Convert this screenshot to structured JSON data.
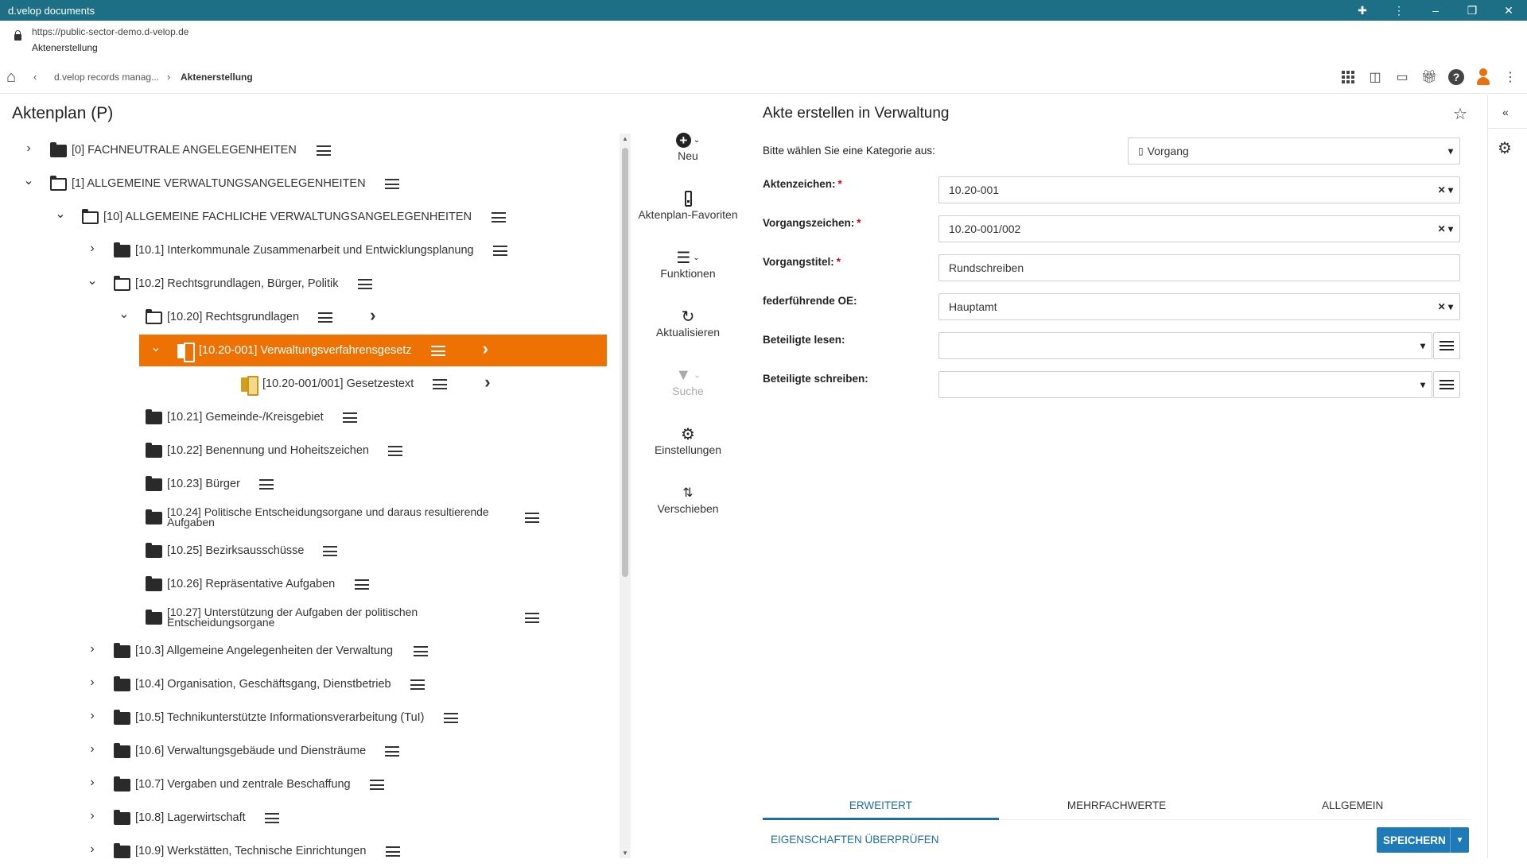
{
  "window": {
    "title": "d.velop documents"
  },
  "browser": {
    "url": "https://public-sector-demo.d-velop.de",
    "page_title": "Aktenerstellung"
  },
  "breadcrumb": {
    "parent": "d.velop records manag...",
    "current": "Aktenerstellung"
  },
  "tree": {
    "title": "Aktenplan (P)",
    "rows": [
      {
        "label": "[0] FACHNEUTRALE ANGELEGENHEITEN"
      },
      {
        "label": "[1] ALLGEMEINE VERWALTUNGSANGELEGENHEITEN"
      },
      {
        "label": "[10] ALLGEMEINE FACHLICHE VERWALTUNGSANGELEGENHEITEN"
      },
      {
        "label": "[10.1] Interkommunale Zusammenarbeit und Entwicklungsplanung"
      },
      {
        "label": "[10.2] Rechtsgrundlagen, Bürger, Politik"
      },
      {
        "label": "[10.20] Rechtsgrundlagen"
      },
      {
        "label": "[10.20-001] Verwaltungsverfahrensgesetz"
      },
      {
        "label": "[10.20-001/001] Gesetzestext"
      },
      {
        "label": "[10.21] Gemeinde-/Kreisgebiet"
      },
      {
        "label": "[10.22] Benennung und Hoheitszeichen"
      },
      {
        "label": "[10.23] Bürger"
      },
      {
        "label": "[10.24] Politische Entscheidungsorgane und daraus resultierende Aufgaben"
      },
      {
        "label": "[10.25] Bezirksausschüsse"
      },
      {
        "label": "[10.26] Repräsentative Aufgaben"
      },
      {
        "label": "[10.27] Unterstützung der Aufgaben der politischen Entscheidungsorgane"
      },
      {
        "label": "[10.3] Allgemeine Angelegenheiten der Verwaltung"
      },
      {
        "label": "[10.4] Organisation, Geschäftsgang, Dienstbetrieb"
      },
      {
        "label": "[10.5] Technikunterstützte Informationsverarbeitung (TuI)"
      },
      {
        "label": "[10.6] Verwaltungsgebäude und Diensträume"
      },
      {
        "label": "[10.7] Vergaben und zentrale Beschaffung"
      },
      {
        "label": "[10.8] Lagerwirtschaft"
      },
      {
        "label": "[10.9] Werkstätten, Technische Einrichtungen"
      }
    ]
  },
  "actions": {
    "neu": "Neu",
    "favoriten": "Aktenplan-Favoriten",
    "funktionen": "Funktionen",
    "aktualisieren": "Aktualisieren",
    "suche": "Suche",
    "einstellungen": "Einstellungen",
    "verschieben": "Verschieben"
  },
  "form": {
    "title": "Akte erstellen in Verwaltung",
    "category_label": "Bitte wählen Sie eine Kategorie aus:",
    "category_value": "Vorgang",
    "aktenzeichen_label": "Aktenzeichen:",
    "aktenzeichen_value": "10.20-001",
    "vorgangszeichen_label": "Vorgangszeichen:",
    "vorgangszeichen_value": "10.20-001/002",
    "vorgangstitel_label": "Vorgangstitel:",
    "vorgangstitel_value": "Rundschreiben",
    "oe_label": "federführende OE:",
    "oe_value": "Hauptamt",
    "lesen_label": "Beteiligte lesen:",
    "lesen_value": "",
    "schreiben_label": "Beteiligte schreiben:",
    "schreiben_value": "",
    "required_mark": "*"
  },
  "tabs": {
    "erweitert": "ERWEITERT",
    "mehrfachwerte": "MEHRFACHWERTE",
    "allgemein": "ALLGEMEIN"
  },
  "footer": {
    "check_link": "EIGENSCHAFTEN ÜBERPRÜFEN",
    "save": "SPEICHERN"
  },
  "colors": {
    "selection": "#ee7203",
    "titlebar": "#1d6f86",
    "primary": "#1f7ab8",
    "required": "#d0021b",
    "avatar": "#e8700d"
  }
}
